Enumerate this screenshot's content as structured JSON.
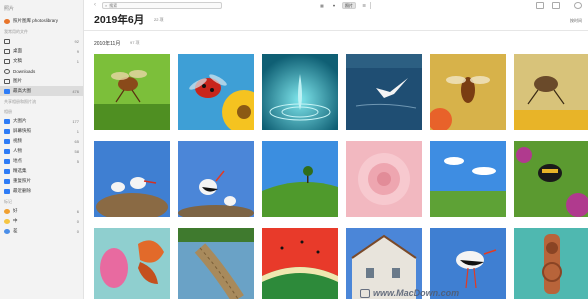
{
  "sidebar": {
    "header": "照片",
    "library_item": {
      "label": "照片图库 photoslibrary"
    },
    "sections": [
      {
        "title": "我常用的文件",
        "items": [
          {
            "label": "",
            "count": "92",
            "icon": "clock-icon"
          },
          {
            "label": "桌面",
            "count": "9",
            "icon": "desktop-folder-icon"
          },
          {
            "label": "文稿",
            "count": "1",
            "icon": "documents-folder-icon"
          },
          {
            "label": "Downloads",
            "count": "",
            "icon": "downloads-icon"
          },
          {
            "label": "图片",
            "count": "",
            "icon": "pictures-folder-icon"
          },
          {
            "label": "最高大图",
            "count": "476",
            "icon": "album-icon",
            "selected": true
          }
        ]
      },
      {
        "title": "共享相册和照片流",
        "items": []
      },
      {
        "title": "相册",
        "items": [
          {
            "label": "大图片",
            "count": "177",
            "icon": "folder-icon"
          },
          {
            "label": "屏幕快照",
            "count": "1",
            "icon": "screenshot-icon"
          },
          {
            "label": "视频",
            "count": "65",
            "icon": "video-icon"
          },
          {
            "label": "人物",
            "count": "58",
            "icon": "people-icon"
          },
          {
            "label": "地点",
            "count": "5",
            "icon": "places-icon"
          },
          {
            "label": "精选集",
            "count": "",
            "icon": "collection-icon"
          },
          {
            "label": "重复照片",
            "count": "",
            "icon": "duplicate-icon"
          },
          {
            "label": "最近删除",
            "count": "",
            "icon": "trash-icon"
          }
        ]
      },
      {
        "title": "标记",
        "items": [
          {
            "label": "好",
            "count": "6",
            "icon": "good-icon"
          },
          {
            "label": "中",
            "count": "0",
            "icon": "neutral-icon"
          },
          {
            "label": "差",
            "count": "0",
            "icon": "bad-icon"
          }
        ]
      }
    ]
  },
  "toolbar": {
    "search_placeholder": "搜索",
    "segment_label": "照片",
    "right_label": "按时间"
  },
  "main": {
    "title": "2019年6月",
    "title_count": "22 项",
    "date_header": "2010年11月",
    "date_count": "97 项"
  },
  "photos": [
    {
      "name": "photo-hornet-flying",
      "subject": "hornet"
    },
    {
      "name": "photo-ladybug-flower",
      "subject": "ladybug"
    },
    {
      "name": "photo-water-drop",
      "subject": "water drop"
    },
    {
      "name": "photo-gull-over-water",
      "subject": "gull"
    },
    {
      "name": "photo-bee-orange",
      "subject": "bee"
    },
    {
      "name": "photo-insect-yellow",
      "subject": "insect"
    },
    {
      "name": "photo-storks-nest",
      "subject": "storks"
    },
    {
      "name": "photo-stork-pair",
      "subject": "storks"
    },
    {
      "name": "photo-green-hill-tree",
      "subject": "hill"
    },
    {
      "name": "photo-pink-rose",
      "subject": "rose"
    },
    {
      "name": "photo-field-sky",
      "subject": "field"
    },
    {
      "name": "photo-bumblebee-flower",
      "subject": "bumblebee"
    },
    {
      "name": "photo-butterfly-flower",
      "subject": "butterfly"
    },
    {
      "name": "photo-palm-tree",
      "subject": "palm"
    },
    {
      "name": "photo-watermelon",
      "subject": "watermelon"
    },
    {
      "name": "photo-house-stork",
      "subject": "house"
    },
    {
      "name": "photo-stork-walking",
      "subject": "stork"
    },
    {
      "name": "photo-door-knocker",
      "subject": "knocker"
    }
  ],
  "watermark": {
    "text": "www.MacDown.com"
  },
  "colors": {
    "accent": "#2e7cf6",
    "selected_bg": "#dcdcdc"
  }
}
